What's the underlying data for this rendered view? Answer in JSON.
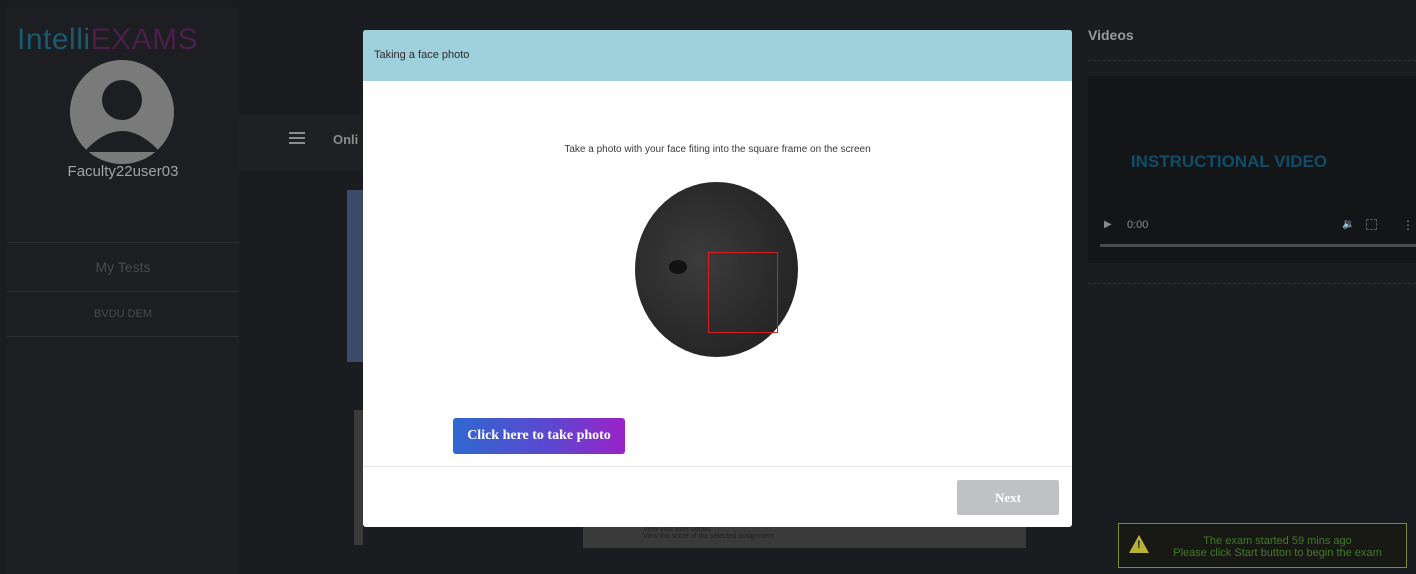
{
  "brand": {
    "part1": "Intelli",
    "part2": "EXAMS"
  },
  "user": {
    "name": "Faculty22user03"
  },
  "sidebar": {
    "items": [
      {
        "label": "My Tests"
      },
      {
        "label": "BVDU DEM"
      }
    ]
  },
  "main": {
    "title_partial": "Onli"
  },
  "background_doc": {
    "line1": "View your user details",
    "line2": "View the score of the selected assignment"
  },
  "modal": {
    "title": "Taking a face photo",
    "instruction": "Take a photo with your face fiting into the square frame on the screen",
    "take_photo_label": "Click here to take photo",
    "next_label": "Next"
  },
  "videos": {
    "title": "Videos",
    "video_title": "INSTRUCTIONAL VIDEO",
    "time": "0:00"
  },
  "alert": {
    "line1": "The exam started 59 mins ago",
    "line2": "Please click Start button to begin the exam"
  },
  "icons": {
    "avatar": "user-avatar-icon",
    "menu": "hamburger-icon",
    "play": "play-icon",
    "volume": "volume-icon",
    "fullscreen": "fullscreen-icon",
    "more": "more-vertical-icon",
    "warning": "warning-icon"
  },
  "colors": {
    "modal_header": "#9fd1dd",
    "take_button_start": "#2f68d0",
    "take_button_end": "#9a22c8",
    "next_button_disabled": "#bfc1c5",
    "face_frame": "#d42020",
    "alert_text": "#3f7a2a"
  }
}
